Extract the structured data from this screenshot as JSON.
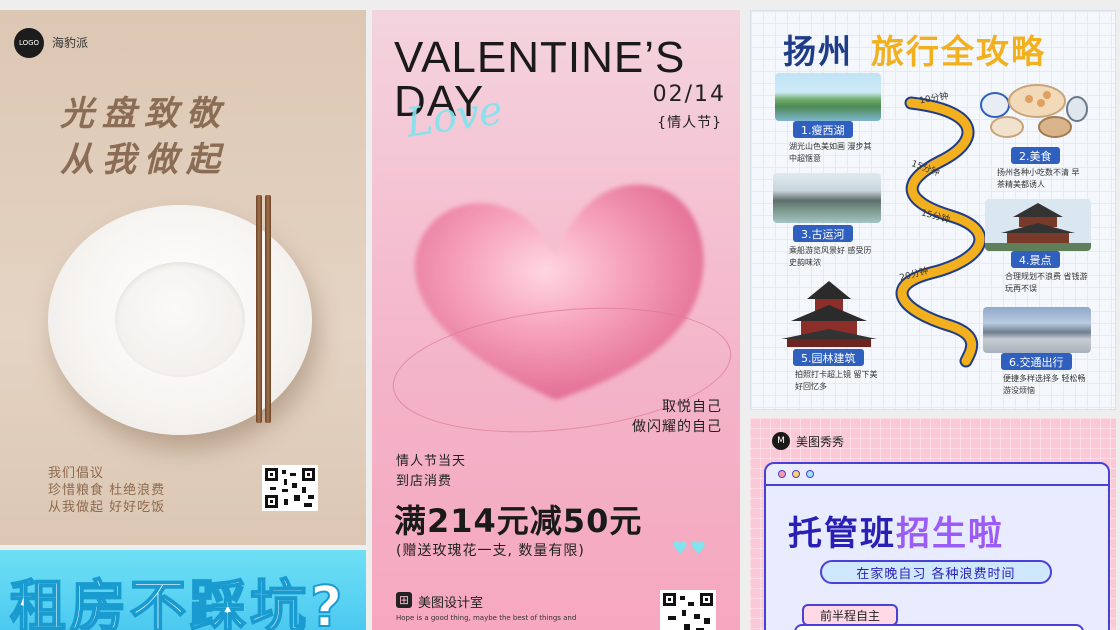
{
  "cards": {
    "food": {
      "logo_text": "LOGO",
      "brand": "海豹派",
      "headline_line1": "光盘致敬",
      "headline_line2": "从我做起",
      "slogan_line1": "我们倡议",
      "slogan_line2": "珍惜粮食  杜绝浪费",
      "slogan_line3": "从我做起  好好吃饭"
    },
    "rent": {
      "headline": "租房不踩坑?"
    },
    "valentine": {
      "title_line1": "VALENTINE’S",
      "title_line2": "DAY",
      "script_word": "Love",
      "date": "02/14",
      "date_label": "{情人节}",
      "tag_line1": "取悦自己",
      "tag_line2": "做闪耀的自己",
      "note_line1": "情人节当天",
      "note_line2": "到店消费",
      "promo": "满214元减50元",
      "gift": "(赠送玫瑰花一支, 数量有限)",
      "mini_hearts": "♥♥",
      "studio": "美图设计室",
      "small_text": "Hope is a good thing, maybe the best of things and"
    },
    "yangzhou": {
      "title_part1": "扬州",
      "title_part2": "旅行全攻略",
      "time_labels": [
        "10分钟",
        "15分钟",
        "15分钟",
        "20分钟"
      ],
      "spots": [
        {
          "label": "1.瘦西湖",
          "desc": "湖光山色美如画 漫步其中超惬意"
        },
        {
          "label": "2.美食",
          "desc": "扬州各种小吃数不清 早茶精美都诱人"
        },
        {
          "label": "3.古运河",
          "desc": "乘船游览风景好 感受历史韵味浓"
        },
        {
          "label": "4.景点",
          "desc": "合理规划不浪费 省钱游玩再不误"
        },
        {
          "label": "5.园林建筑",
          "desc": "拍照打卡超上镜 留下美好回忆多"
        },
        {
          "label": "6.交通出行",
          "desc": "便捷多样选择多 轻松畅游没烦恼"
        }
      ]
    },
    "class": {
      "brand_icon": "M",
      "brand": "美图秀秀",
      "headline_a": "托管班",
      "headline_b": "招生啦",
      "pill": "在家晚自习 各种浪费时间",
      "sub": "前半程自主"
    }
  },
  "colors": {
    "food_headline": "#8b6c54",
    "valentine_accent": "#7fe4ee",
    "yz_blue": "#1f3c88",
    "yz_yellow": "#f2b01e",
    "class_purple": "#4a3fd6"
  }
}
